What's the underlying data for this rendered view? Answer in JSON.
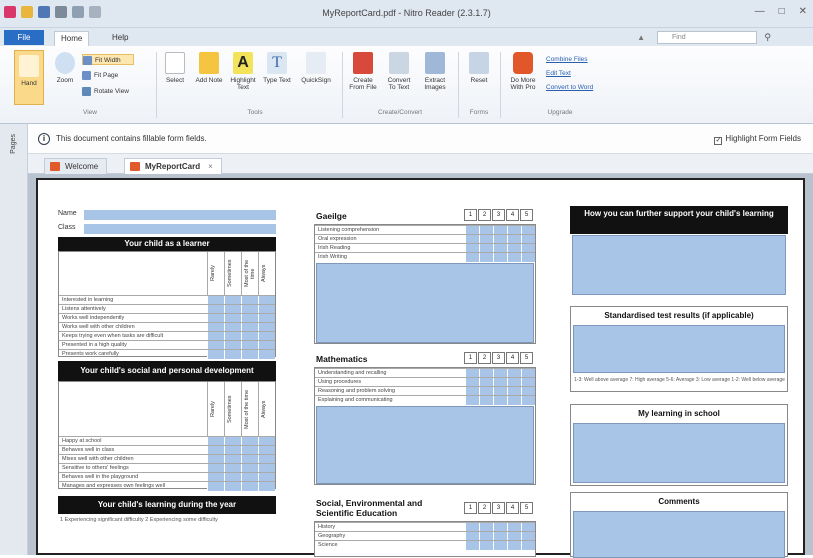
{
  "window": {
    "title": "MyReportCard.pdf - Nitro Reader (2.3.1.7)"
  },
  "ribbon_tabs": {
    "file": "File",
    "home": "Home",
    "help": "Help"
  },
  "search": {
    "placeholder": "Find"
  },
  "ribbon": {
    "hand": "Hand",
    "zoom": "Zoom",
    "fit_width": "Fit Width",
    "fit_page": "Fit Page",
    "rotate_view": "Rotate View",
    "view_group": "View",
    "select": "Select",
    "add_note": "Add Note",
    "highlight_text": "Highlight Text",
    "type_text": "Type Text",
    "quicksign": "QuickSign",
    "tools_group": "Tools",
    "create_from_file": "Create From File",
    "convert_to_text": "Convert To Text",
    "extract_images": "Extract Images",
    "create_convert_group": "Create/Convert",
    "reset": "Reset",
    "forms_group": "Forms",
    "do_more": "Do More With Pro",
    "combine_files": "Combine Files",
    "edit_text": "Edit Text",
    "convert_to_word": "Convert to Word",
    "upgrade_group": "Upgrade"
  },
  "side_panel": {
    "pages": "Pages"
  },
  "notification": {
    "text": "This document contains fillable form fields.",
    "highlight": "Highlight Form Fields"
  },
  "doc_tabs": {
    "welcome": "Welcome",
    "report": "MyReportCard"
  },
  "report": {
    "name_label": "Name",
    "class_label": "Class",
    "learner_header": "Your child as a learner",
    "rating_cols": [
      "Rarely",
      "Sometimes",
      "Most of the time",
      "Always"
    ],
    "learner_items": [
      "Interested in learning",
      "Listens attentively",
      "Works well independently",
      "Works well with other children",
      "Keeps trying even when tasks are difficult",
      "Presented in a high quality",
      "Presents work carefully"
    ],
    "social_header": "Your child's social and personal development",
    "social_items": [
      "Happy at school",
      "Behaves well in class",
      "Mixes well with other children",
      "Sensitive to others' feelings",
      "Behaves well in the playground",
      "Manages and expresses own feelings well"
    ],
    "year_header": "Your child's learning during the year",
    "year_note": "1 Experiencing significant difficulty  2 Experiencing some difficulty",
    "gaeilge_title": "Gaeilge",
    "gaeilge_items": [
      "Listening comprehension",
      "Oral expression",
      "Irish Reading",
      "Irish Writing"
    ],
    "maths_title": "Mathematics",
    "maths_items": [
      "Understanding and recalling",
      "Using procedures",
      "Reasoning and problem solving",
      "Explaining and communicating"
    ],
    "sese_title": "Social, Environmental and Scientific Education",
    "sese_items": [
      "History",
      "Geography",
      "Science"
    ],
    "numbers": [
      "1",
      "2",
      "3",
      "4",
      "5"
    ],
    "support_header": "How you can further support your child's learning",
    "standardised_header": "Standardised test results (if applicable)",
    "standardised_note": "1-3: Well above average  7: High average  5-6: Average  3: Low average  1-2: Well below average",
    "my_learning_header": "My learning in school",
    "comments_header": "Comments"
  }
}
